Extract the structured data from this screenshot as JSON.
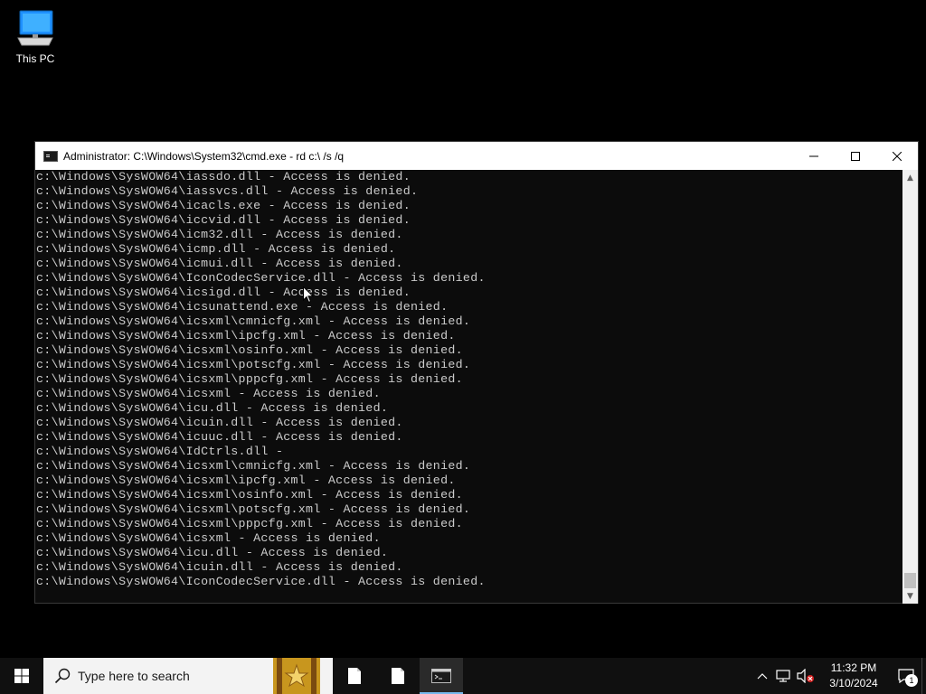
{
  "desktop": {
    "icons": [
      {
        "label": "This PC",
        "icon": "this-pc-icon"
      }
    ]
  },
  "cmd_window": {
    "title": "Administrator: C:\\Windows\\System32\\cmd.exe - rd  c:\\ /s /q",
    "lines": [
      "c:\\Windows\\SysWOW64\\iassdo.dll - Access is denied.",
      "c:\\Windows\\SysWOW64\\iassvcs.dll - Access is denied.",
      "c:\\Windows\\SysWOW64\\icacls.exe - Access is denied.",
      "c:\\Windows\\SysWOW64\\iccvid.dll - Access is denied.",
      "c:\\Windows\\SysWOW64\\icm32.dll - Access is denied.",
      "c:\\Windows\\SysWOW64\\icmp.dll - Access is denied.",
      "c:\\Windows\\SysWOW64\\icmui.dll - Access is denied.",
      "c:\\Windows\\SysWOW64\\IconCodecService.dll - Access is denied.",
      "c:\\Windows\\SysWOW64\\icsigd.dll - Access is denied.",
      "c:\\Windows\\SysWOW64\\icsunattend.exe - Access is denied.",
      "c:\\Windows\\SysWOW64\\icsxml\\cmnicfg.xml - Access is denied.",
      "c:\\Windows\\SysWOW64\\icsxml\\ipcfg.xml - Access is denied.",
      "c:\\Windows\\SysWOW64\\icsxml\\osinfo.xml - Access is denied.",
      "c:\\Windows\\SysWOW64\\icsxml\\potscfg.xml - Access is denied.",
      "c:\\Windows\\SysWOW64\\icsxml\\pppcfg.xml - Access is denied.",
      "c:\\Windows\\SysWOW64\\icsxml - Access is denied.",
      "c:\\Windows\\SysWOW64\\icu.dll - Access is denied.",
      "c:\\Windows\\SysWOW64\\icuin.dll - Access is denied.",
      "c:\\Windows\\SysWOW64\\icuuc.dll - Access is denied.",
      "c:\\Windows\\SysWOW64\\IdCtrls.dll -",
      "c:\\Windows\\SysWOW64\\icsxml\\cmnicfg.xml - Access is denied.",
      "c:\\Windows\\SysWOW64\\icsxml\\ipcfg.xml - Access is denied.",
      "c:\\Windows\\SysWOW64\\icsxml\\osinfo.xml - Access is denied.",
      "c:\\Windows\\SysWOW64\\icsxml\\potscfg.xml - Access is denied.",
      "c:\\Windows\\SysWOW64\\icsxml\\pppcfg.xml - Access is denied.",
      "c:\\Windows\\SysWOW64\\icsxml - Access is denied.",
      "c:\\Windows\\SysWOW64\\icu.dll - Access is denied.",
      "c:\\Windows\\SysWOW64\\icuin.dll - Access is denied.",
      "c:\\Windows\\SysWOW64\\IconCodecService.dll - Access is denied."
    ]
  },
  "taskbar": {
    "search_placeholder": "Type here to search",
    "time": "11:32 PM",
    "date": "3/10/2024",
    "notification_count": "1"
  },
  "colors": {
    "console_bg": "#0c0c0c",
    "console_text": "#cccccc",
    "taskbar_bg": "#101010",
    "active_indicator": "#76b9ed"
  }
}
